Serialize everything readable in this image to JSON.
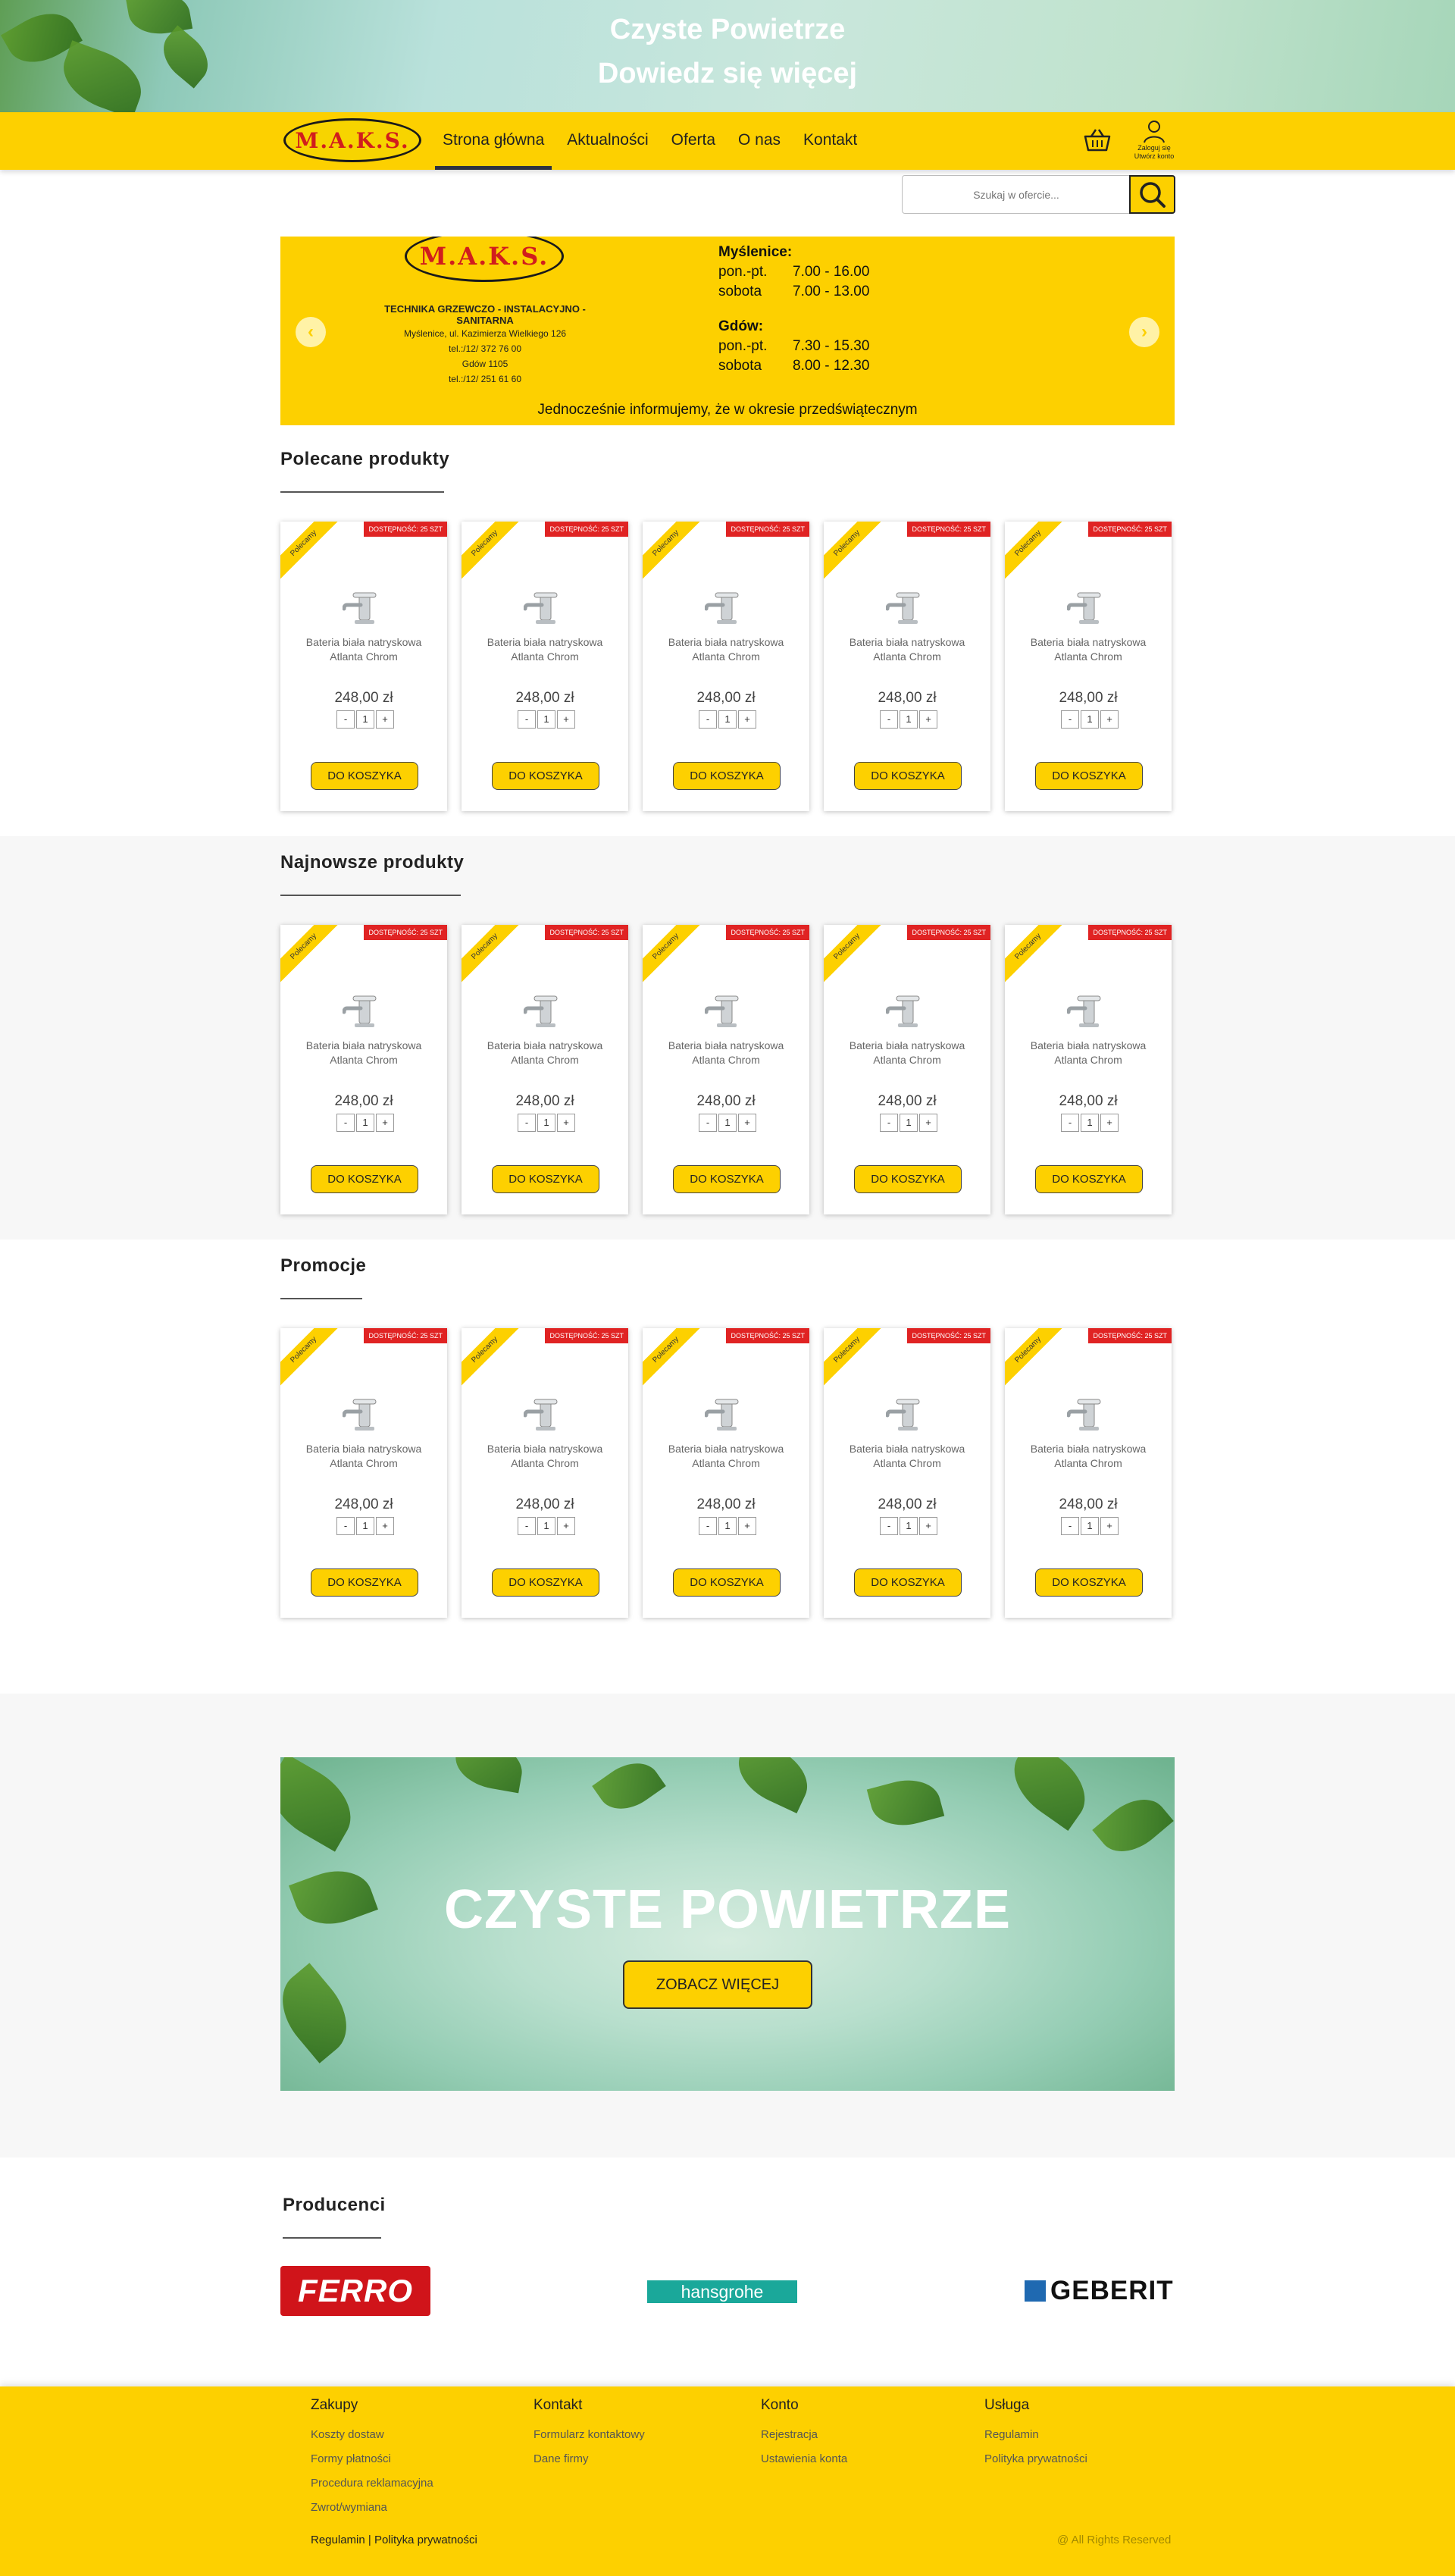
{
  "top_banner": {
    "line1": "Czyste Powietrze",
    "line2": "Dowiedz się więcej"
  },
  "nav": {
    "logo": "M.A.K.S.",
    "items": [
      "Strona główna",
      "Aktualności",
      "Oferta",
      "O nas",
      "Kontakt"
    ],
    "active_index": 0,
    "account_line1": "Zaloguj się",
    "account_line2": "Utwórz konto"
  },
  "search": {
    "placeholder": "Szukaj w ofercie..."
  },
  "slider": {
    "logo": "M.A.K.S.",
    "tagline": "TECHNIKA GRZEWCZO - INSTALACYJNO - SANITARNA",
    "address_line1": "Myślenice, ul. Kazimierza Wielkiego 126",
    "address_line2": "tel.:/12/ 372 76 00",
    "address_line3": "Gdów 1105",
    "address_line4": "tel.:/12/ 251 61 60",
    "city1": "Myślenice:",
    "city1_row1_day": "pon.-pt.",
    "city1_row1_time": "7.00 - 16.00",
    "city1_row2_day": "sobota",
    "city1_row2_time": "7.00 - 13.00",
    "city2": "Gdów:",
    "city2_row1_day": "pon.-pt.",
    "city2_row1_time": "7.30 - 15.30",
    "city2_row2_day": "sobota",
    "city2_row2_time": "8.00 - 12.30",
    "notice": "Jednocześnie informujemy, że w okresie przedświątecznym"
  },
  "sections": [
    {
      "title": "Polecane produkty"
    },
    {
      "title": "Najnowsze produkty"
    },
    {
      "title": "Promocje"
    }
  ],
  "product": {
    "ribbon": "Polecamy",
    "stock": "DOSTĘPNOŚĆ: 25 SZT",
    "name_line1": "Bateria biała natryskowa",
    "name_line2": "Atlanta Chrom",
    "price": "248,00 zł",
    "qty_minus": "-",
    "qty_value": "1",
    "qty_plus": "+",
    "button": "DO KOSZYKA"
  },
  "promo": {
    "title": "CZYSTE POWIETRZE",
    "button": "ZOBACZ WIĘCEJ"
  },
  "producers": {
    "title": "Producenci",
    "brands": [
      "FERRO",
      "hansgrohe",
      "GEBERIT"
    ]
  },
  "footer": {
    "columns": [
      {
        "heading": "Zakupy",
        "links": [
          "Koszty dostaw",
          "Formy płatności",
          "Procedura reklamacyjna",
          "Zwrot/wymiana"
        ]
      },
      {
        "heading": "Kontakt",
        "links": [
          "Formularz kontaktowy",
          "Dane firmy"
        ]
      },
      {
        "heading": "Konto",
        "links": [
          "Rejestracja",
          "Ustawienia konta"
        ]
      },
      {
        "heading": "Usługa",
        "links": [
          "Regulamin",
          "Polityka prywatności"
        ]
      }
    ],
    "legal_link1": "Regulamin",
    "legal_sep": "|",
    "legal_link2": "Polityka prywatności",
    "rights": "@ All Rights Reserved"
  },
  "colors": {
    "brand_yellow": "#fdd000",
    "stock_red": "#e02323",
    "nav_active": "#2e3140"
  }
}
